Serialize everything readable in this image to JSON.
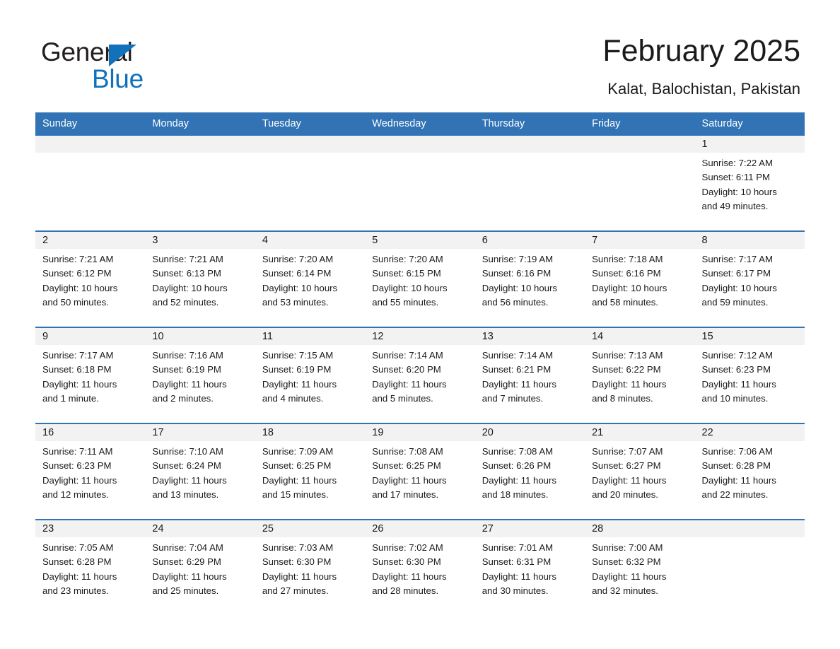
{
  "brand": {
    "name_part1": "General",
    "name_part2": "Blue",
    "triangle_color": "#1271bb",
    "accent_color": "#3173b5"
  },
  "header": {
    "month_title": "February 2025",
    "location": "Kalat, Balochistan, Pakistan"
  },
  "calendar": {
    "weekday_headers": [
      "Sunday",
      "Monday",
      "Tuesday",
      "Wednesday",
      "Thursday",
      "Friday",
      "Saturday"
    ],
    "weeks": [
      {
        "days": [
          {
            "date": "",
            "empty": true
          },
          {
            "date": "",
            "empty": true
          },
          {
            "date": "",
            "empty": true
          },
          {
            "date": "",
            "empty": true
          },
          {
            "date": "",
            "empty": true
          },
          {
            "date": "",
            "empty": true
          },
          {
            "date": "1",
            "sunrise": "Sunrise: 7:22 AM",
            "sunset": "Sunset: 6:11 PM",
            "daylight1": "Daylight: 10 hours",
            "daylight2": "and 49 minutes."
          }
        ]
      },
      {
        "days": [
          {
            "date": "2",
            "sunrise": "Sunrise: 7:21 AM",
            "sunset": "Sunset: 6:12 PM",
            "daylight1": "Daylight: 10 hours",
            "daylight2": "and 50 minutes."
          },
          {
            "date": "3",
            "sunrise": "Sunrise: 7:21 AM",
            "sunset": "Sunset: 6:13 PM",
            "daylight1": "Daylight: 10 hours",
            "daylight2": "and 52 minutes."
          },
          {
            "date": "4",
            "sunrise": "Sunrise: 7:20 AM",
            "sunset": "Sunset: 6:14 PM",
            "daylight1": "Daylight: 10 hours",
            "daylight2": "and 53 minutes."
          },
          {
            "date": "5",
            "sunrise": "Sunrise: 7:20 AM",
            "sunset": "Sunset: 6:15 PM",
            "daylight1": "Daylight: 10 hours",
            "daylight2": "and 55 minutes."
          },
          {
            "date": "6",
            "sunrise": "Sunrise: 7:19 AM",
            "sunset": "Sunset: 6:16 PM",
            "daylight1": "Daylight: 10 hours",
            "daylight2": "and 56 minutes."
          },
          {
            "date": "7",
            "sunrise": "Sunrise: 7:18 AM",
            "sunset": "Sunset: 6:16 PM",
            "daylight1": "Daylight: 10 hours",
            "daylight2": "and 58 minutes."
          },
          {
            "date": "8",
            "sunrise": "Sunrise: 7:17 AM",
            "sunset": "Sunset: 6:17 PM",
            "daylight1": "Daylight: 10 hours",
            "daylight2": "and 59 minutes."
          }
        ]
      },
      {
        "days": [
          {
            "date": "9",
            "sunrise": "Sunrise: 7:17 AM",
            "sunset": "Sunset: 6:18 PM",
            "daylight1": "Daylight: 11 hours",
            "daylight2": "and 1 minute."
          },
          {
            "date": "10",
            "sunrise": "Sunrise: 7:16 AM",
            "sunset": "Sunset: 6:19 PM",
            "daylight1": "Daylight: 11 hours",
            "daylight2": "and 2 minutes."
          },
          {
            "date": "11",
            "sunrise": "Sunrise: 7:15 AM",
            "sunset": "Sunset: 6:19 PM",
            "daylight1": "Daylight: 11 hours",
            "daylight2": "and 4 minutes."
          },
          {
            "date": "12",
            "sunrise": "Sunrise: 7:14 AM",
            "sunset": "Sunset: 6:20 PM",
            "daylight1": "Daylight: 11 hours",
            "daylight2": "and 5 minutes."
          },
          {
            "date": "13",
            "sunrise": "Sunrise: 7:14 AM",
            "sunset": "Sunset: 6:21 PM",
            "daylight1": "Daylight: 11 hours",
            "daylight2": "and 7 minutes."
          },
          {
            "date": "14",
            "sunrise": "Sunrise: 7:13 AM",
            "sunset": "Sunset: 6:22 PM",
            "daylight1": "Daylight: 11 hours",
            "daylight2": "and 8 minutes."
          },
          {
            "date": "15",
            "sunrise": "Sunrise: 7:12 AM",
            "sunset": "Sunset: 6:23 PM",
            "daylight1": "Daylight: 11 hours",
            "daylight2": "and 10 minutes."
          }
        ]
      },
      {
        "days": [
          {
            "date": "16",
            "sunrise": "Sunrise: 7:11 AM",
            "sunset": "Sunset: 6:23 PM",
            "daylight1": "Daylight: 11 hours",
            "daylight2": "and 12 minutes."
          },
          {
            "date": "17",
            "sunrise": "Sunrise: 7:10 AM",
            "sunset": "Sunset: 6:24 PM",
            "daylight1": "Daylight: 11 hours",
            "daylight2": "and 13 minutes."
          },
          {
            "date": "18",
            "sunrise": "Sunrise: 7:09 AM",
            "sunset": "Sunset: 6:25 PM",
            "daylight1": "Daylight: 11 hours",
            "daylight2": "and 15 minutes."
          },
          {
            "date": "19",
            "sunrise": "Sunrise: 7:08 AM",
            "sunset": "Sunset: 6:25 PM",
            "daylight1": "Daylight: 11 hours",
            "daylight2": "and 17 minutes."
          },
          {
            "date": "20",
            "sunrise": "Sunrise: 7:08 AM",
            "sunset": "Sunset: 6:26 PM",
            "daylight1": "Daylight: 11 hours",
            "daylight2": "and 18 minutes."
          },
          {
            "date": "21",
            "sunrise": "Sunrise: 7:07 AM",
            "sunset": "Sunset: 6:27 PM",
            "daylight1": "Daylight: 11 hours",
            "daylight2": "and 20 minutes."
          },
          {
            "date": "22",
            "sunrise": "Sunrise: 7:06 AM",
            "sunset": "Sunset: 6:28 PM",
            "daylight1": "Daylight: 11 hours",
            "daylight2": "and 22 minutes."
          }
        ]
      },
      {
        "days": [
          {
            "date": "23",
            "sunrise": "Sunrise: 7:05 AM",
            "sunset": "Sunset: 6:28 PM",
            "daylight1": "Daylight: 11 hours",
            "daylight2": "and 23 minutes."
          },
          {
            "date": "24",
            "sunrise": "Sunrise: 7:04 AM",
            "sunset": "Sunset: 6:29 PM",
            "daylight1": "Daylight: 11 hours",
            "daylight2": "and 25 minutes."
          },
          {
            "date": "25",
            "sunrise": "Sunrise: 7:03 AM",
            "sunset": "Sunset: 6:30 PM",
            "daylight1": "Daylight: 11 hours",
            "daylight2": "and 27 minutes."
          },
          {
            "date": "26",
            "sunrise": "Sunrise: 7:02 AM",
            "sunset": "Sunset: 6:30 PM",
            "daylight1": "Daylight: 11 hours",
            "daylight2": "and 28 minutes."
          },
          {
            "date": "27",
            "sunrise": "Sunrise: 7:01 AM",
            "sunset": "Sunset: 6:31 PM",
            "daylight1": "Daylight: 11 hours",
            "daylight2": "and 30 minutes."
          },
          {
            "date": "28",
            "sunrise": "Sunrise: 7:00 AM",
            "sunset": "Sunset: 6:32 PM",
            "daylight1": "Daylight: 11 hours",
            "daylight2": "and 32 minutes."
          },
          {
            "date": "",
            "empty": true
          }
        ]
      }
    ]
  }
}
